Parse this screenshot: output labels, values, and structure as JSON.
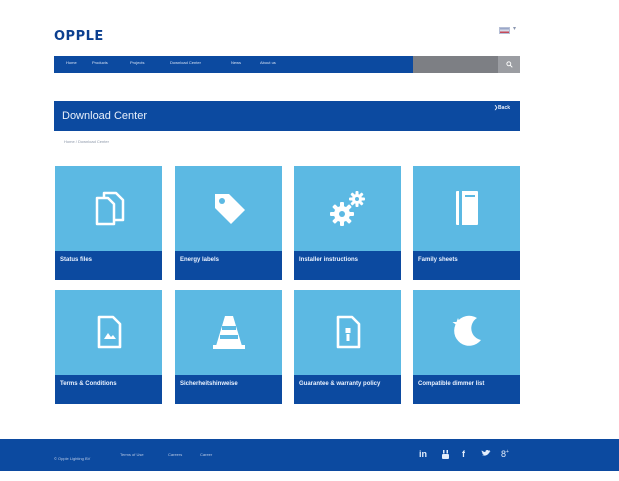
{
  "header": {
    "logo_text": "OPPLE",
    "language_flag": "uk-flag-icon",
    "language_caret": "▾"
  },
  "nav": {
    "items": [
      "Home",
      "Products",
      "Projects",
      "Download Center",
      "News",
      "About us"
    ],
    "search_placeholder": "",
    "search_icon": "search-icon"
  },
  "page": {
    "title": "Download Center",
    "back_label": "Back",
    "breadcrumb": "Home / Download Center"
  },
  "tiles": [
    {
      "label": "Status files",
      "icon": "documents-icon"
    },
    {
      "label": "Energy labels",
      "icon": "tag-icon"
    },
    {
      "label": "Installer instructions",
      "icon": "gears-icon"
    },
    {
      "label": "Family sheets",
      "icon": "book-icon"
    },
    {
      "label": "Terms & Conditions",
      "icon": "document-icon"
    },
    {
      "label": "Sicherheitshinweise",
      "icon": "traffic-cone-icon"
    },
    {
      "label": "Guarantee & warranty policy",
      "icon": "certificate-icon"
    },
    {
      "label": "Compatible dimmer list",
      "icon": "moon-star-icon"
    }
  ],
  "footer": {
    "copyright": "© Opple Lighting BV",
    "links": [
      "Terms of Use",
      "Careers",
      "Career"
    ],
    "social": [
      "in",
      "You Tube",
      "f",
      "twitter",
      "g+"
    ]
  },
  "colors": {
    "brand_blue": "#0c4aa0",
    "tile_light_blue": "#5cb9e3",
    "white": "#ffffff",
    "search_gray": "#7d7f84"
  }
}
